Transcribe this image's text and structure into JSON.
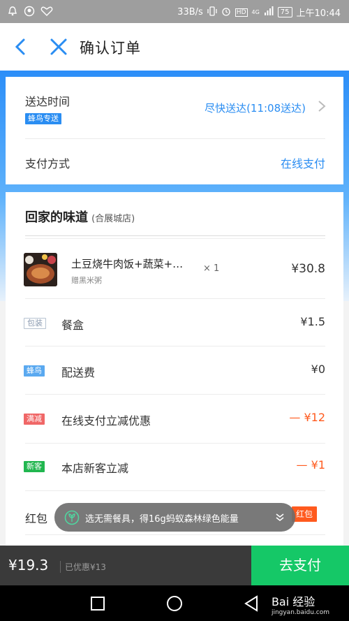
{
  "status_bar": {
    "network_speed": "33B/s",
    "network_type": "4G",
    "battery": "75",
    "time": "上午10:44"
  },
  "header": {
    "title": "确认订单"
  },
  "delivery": {
    "label": "送达时间",
    "badge": "蜂鸟专送",
    "value": "尽快送达(11:08送达)"
  },
  "payment": {
    "label": "支付方式",
    "value": "在线支付"
  },
  "shop": {
    "name": "回家的味道",
    "branch": "(合展城店)"
  },
  "item": {
    "name": "土豆烧牛肉饭+蔬菜+…",
    "gift": "赠黑米粥",
    "quantity": "× 1",
    "price": "¥30.8"
  },
  "fees": [
    {
      "tag": "包装",
      "label": "餐盒",
      "amount": "¥1.5"
    },
    {
      "tag": "蜂鸟",
      "label": "配送费",
      "amount": "¥0"
    },
    {
      "tag": "满减",
      "label": "在线支付立减优惠",
      "amount": "— ¥12"
    },
    {
      "tag": "新客",
      "label": "本店新客立减",
      "amount": "— ¥1"
    }
  ],
  "redpacket": {
    "label": "红包",
    "tag": "红包"
  },
  "toast": {
    "message": "选无需餐具，得16g蚂蚁森林绿色能量"
  },
  "bottom_bar": {
    "total": "¥19.3",
    "discount": "已优惠¥13",
    "pay_button": "去支付"
  },
  "watermark": {
    "brand": "Bai 经验",
    "url": "jingyan.baidu.com"
  },
  "colors": {
    "accent": "#2a8df2",
    "pay_green": "#15c867",
    "discount_orange": "#ff5a1e"
  }
}
